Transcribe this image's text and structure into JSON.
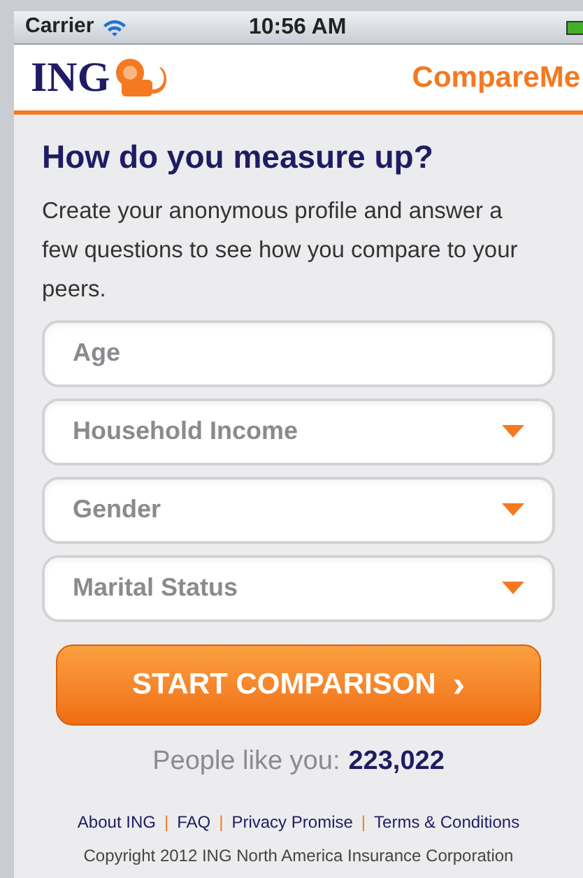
{
  "status_bar": {
    "carrier": "Carrier",
    "time": "10:56 AM"
  },
  "header": {
    "logo": "ING",
    "app_name": "CompareMe"
  },
  "heading": "How do you measure up?",
  "intro": "Create your anonymous profile and answer a few questions to see how you compare to your peers.",
  "fields": [
    {
      "kind": "text",
      "placeholder": "Age"
    },
    {
      "kind": "select",
      "placeholder": "Household Income"
    },
    {
      "kind": "select",
      "placeholder": "Gender"
    },
    {
      "kind": "select",
      "placeholder": "Marital Status"
    }
  ],
  "button": {
    "label": "START COMPARISON",
    "chevron": "›"
  },
  "people": {
    "label": "People like you:",
    "count": "223,022"
  },
  "footer": {
    "separator": "|",
    "links": [
      "About ING",
      "FAQ",
      "Privacy Promise",
      "Terms & Conditions"
    ],
    "copyright": "Copyright 2012 ING North America Insurance Corporation"
  }
}
